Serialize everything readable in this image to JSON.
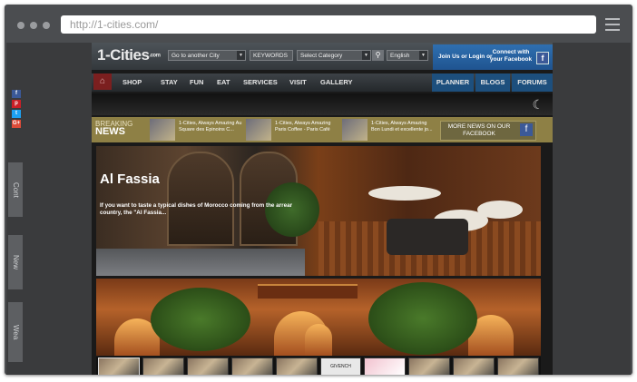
{
  "browser": {
    "url": "http://1-cities.com/"
  },
  "side": {
    "social": [
      "f",
      "p",
      "t",
      "G+"
    ],
    "tabs": [
      "Cont",
      "New",
      "Wea"
    ]
  },
  "site": {
    "logo_text": "1-Cities",
    "logo_suffix": ".com",
    "city_select": "Go to another City",
    "keywords_placeholder": "KEYWORDS",
    "category_select": "Select Category",
    "language_select": "English",
    "login_label": "Join Us or Login or",
    "connect_label": "Connect with your Facebook",
    "nav": [
      "SHOP",
      "STAY",
      "FUN",
      "EAT",
      "SERVICES",
      "VISIT",
      "GALLERY"
    ],
    "nav_right": [
      "PLANNER",
      "BLOGS",
      "FORUMS"
    ],
    "breaking_top": "BREAKING",
    "breaking_bottom": "NEWS",
    "news": [
      "1-Cities, Always Amazing Au Square des Epinoins C...",
      "1-Cities, Always Amazing Paris Coffee - Paris Café",
      "1-Cities, Always Amazing Bon Lundi et excellente jo..."
    ],
    "more_news": "MORE NEWS ON OUR FACEBOOK",
    "hero_title": "Al Fassia",
    "hero_desc": "If you want to taste a typical dishes of Morocco coming from the arrear country, the \"Al Fassia...",
    "thumb_labels": [
      "",
      "",
      "",
      "",
      "",
      "GIVENCH",
      "",
      "",
      "",
      ""
    ]
  },
  "colors": {
    "frame": "#4b4d50",
    "ticker": "#8e8045",
    "login": "#2f6fb0",
    "home": "#7b1f1f"
  }
}
